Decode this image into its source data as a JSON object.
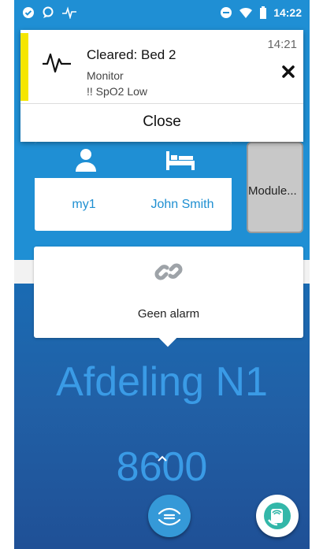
{
  "status_bar": {
    "time": "14:22",
    "left_icons": [
      "check-circle-icon",
      "chat-icon",
      "heartbeat-icon"
    ],
    "right_icons": [
      "minus-circle-icon",
      "wifi-icon",
      "battery-icon"
    ]
  },
  "notification": {
    "accent_color": "#f5e600",
    "icon": "waveform-icon",
    "title": "Cleared: Bed 2",
    "source": "Monitor",
    "detail": "!! SpO2 Low",
    "time": "14:21",
    "dismiss_icon": "close-icon",
    "close_label": "Close"
  },
  "patient_card": {
    "person_icon": "person-icon",
    "bed_icon": "bed-icon",
    "user_name": "my1",
    "patient_name": "John Smith"
  },
  "module": {
    "label": "Module..."
  },
  "alarm_popup": {
    "icon": "link-icon",
    "message": "Geen alarm"
  },
  "ward": {
    "name": "Afdeling N1",
    "number": "8600"
  },
  "bottom": {
    "expand_icon": "chevron-up-icon",
    "left_button_icon": "hand-care-icon",
    "right_button_icon": "nfc-phone-icon"
  },
  "colors": {
    "brand_blue": "#1f8fd4",
    "text_blue": "#1e8fd1",
    "big_text_blue": "#3a9be6"
  }
}
